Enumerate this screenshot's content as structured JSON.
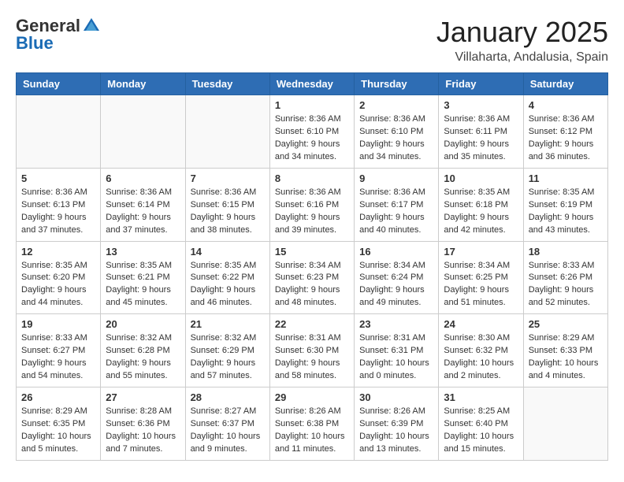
{
  "logo": {
    "general": "General",
    "blue": "Blue"
  },
  "title": "January 2025",
  "location": "Villaharta, Andalusia, Spain",
  "days": [
    "Sunday",
    "Monday",
    "Tuesday",
    "Wednesday",
    "Thursday",
    "Friday",
    "Saturday"
  ],
  "weeks": [
    [
      {
        "day": "",
        "info": ""
      },
      {
        "day": "",
        "info": ""
      },
      {
        "day": "",
        "info": ""
      },
      {
        "day": "1",
        "info": "Sunrise: 8:36 AM\nSunset: 6:10 PM\nDaylight: 9 hours\nand 34 minutes."
      },
      {
        "day": "2",
        "info": "Sunrise: 8:36 AM\nSunset: 6:10 PM\nDaylight: 9 hours\nand 34 minutes."
      },
      {
        "day": "3",
        "info": "Sunrise: 8:36 AM\nSunset: 6:11 PM\nDaylight: 9 hours\nand 35 minutes."
      },
      {
        "day": "4",
        "info": "Sunrise: 8:36 AM\nSunset: 6:12 PM\nDaylight: 9 hours\nand 36 minutes."
      }
    ],
    [
      {
        "day": "5",
        "info": "Sunrise: 8:36 AM\nSunset: 6:13 PM\nDaylight: 9 hours\nand 37 minutes."
      },
      {
        "day": "6",
        "info": "Sunrise: 8:36 AM\nSunset: 6:14 PM\nDaylight: 9 hours\nand 37 minutes."
      },
      {
        "day": "7",
        "info": "Sunrise: 8:36 AM\nSunset: 6:15 PM\nDaylight: 9 hours\nand 38 minutes."
      },
      {
        "day": "8",
        "info": "Sunrise: 8:36 AM\nSunset: 6:16 PM\nDaylight: 9 hours\nand 39 minutes."
      },
      {
        "day": "9",
        "info": "Sunrise: 8:36 AM\nSunset: 6:17 PM\nDaylight: 9 hours\nand 40 minutes."
      },
      {
        "day": "10",
        "info": "Sunrise: 8:35 AM\nSunset: 6:18 PM\nDaylight: 9 hours\nand 42 minutes."
      },
      {
        "day": "11",
        "info": "Sunrise: 8:35 AM\nSunset: 6:19 PM\nDaylight: 9 hours\nand 43 minutes."
      }
    ],
    [
      {
        "day": "12",
        "info": "Sunrise: 8:35 AM\nSunset: 6:20 PM\nDaylight: 9 hours\nand 44 minutes."
      },
      {
        "day": "13",
        "info": "Sunrise: 8:35 AM\nSunset: 6:21 PM\nDaylight: 9 hours\nand 45 minutes."
      },
      {
        "day": "14",
        "info": "Sunrise: 8:35 AM\nSunset: 6:22 PM\nDaylight: 9 hours\nand 46 minutes."
      },
      {
        "day": "15",
        "info": "Sunrise: 8:34 AM\nSunset: 6:23 PM\nDaylight: 9 hours\nand 48 minutes."
      },
      {
        "day": "16",
        "info": "Sunrise: 8:34 AM\nSunset: 6:24 PM\nDaylight: 9 hours\nand 49 minutes."
      },
      {
        "day": "17",
        "info": "Sunrise: 8:34 AM\nSunset: 6:25 PM\nDaylight: 9 hours\nand 51 minutes."
      },
      {
        "day": "18",
        "info": "Sunrise: 8:33 AM\nSunset: 6:26 PM\nDaylight: 9 hours\nand 52 minutes."
      }
    ],
    [
      {
        "day": "19",
        "info": "Sunrise: 8:33 AM\nSunset: 6:27 PM\nDaylight: 9 hours\nand 54 minutes."
      },
      {
        "day": "20",
        "info": "Sunrise: 8:32 AM\nSunset: 6:28 PM\nDaylight: 9 hours\nand 55 minutes."
      },
      {
        "day": "21",
        "info": "Sunrise: 8:32 AM\nSunset: 6:29 PM\nDaylight: 9 hours\nand 57 minutes."
      },
      {
        "day": "22",
        "info": "Sunrise: 8:31 AM\nSunset: 6:30 PM\nDaylight: 9 hours\nand 58 minutes."
      },
      {
        "day": "23",
        "info": "Sunrise: 8:31 AM\nSunset: 6:31 PM\nDaylight: 10 hours\nand 0 minutes."
      },
      {
        "day": "24",
        "info": "Sunrise: 8:30 AM\nSunset: 6:32 PM\nDaylight: 10 hours\nand 2 minutes."
      },
      {
        "day": "25",
        "info": "Sunrise: 8:29 AM\nSunset: 6:33 PM\nDaylight: 10 hours\nand 4 minutes."
      }
    ],
    [
      {
        "day": "26",
        "info": "Sunrise: 8:29 AM\nSunset: 6:35 PM\nDaylight: 10 hours\nand 5 minutes."
      },
      {
        "day": "27",
        "info": "Sunrise: 8:28 AM\nSunset: 6:36 PM\nDaylight: 10 hours\nand 7 minutes."
      },
      {
        "day": "28",
        "info": "Sunrise: 8:27 AM\nSunset: 6:37 PM\nDaylight: 10 hours\nand 9 minutes."
      },
      {
        "day": "29",
        "info": "Sunrise: 8:26 AM\nSunset: 6:38 PM\nDaylight: 10 hours\nand 11 minutes."
      },
      {
        "day": "30",
        "info": "Sunrise: 8:26 AM\nSunset: 6:39 PM\nDaylight: 10 hours\nand 13 minutes."
      },
      {
        "day": "31",
        "info": "Sunrise: 8:25 AM\nSunset: 6:40 PM\nDaylight: 10 hours\nand 15 minutes."
      },
      {
        "day": "",
        "info": ""
      }
    ]
  ]
}
